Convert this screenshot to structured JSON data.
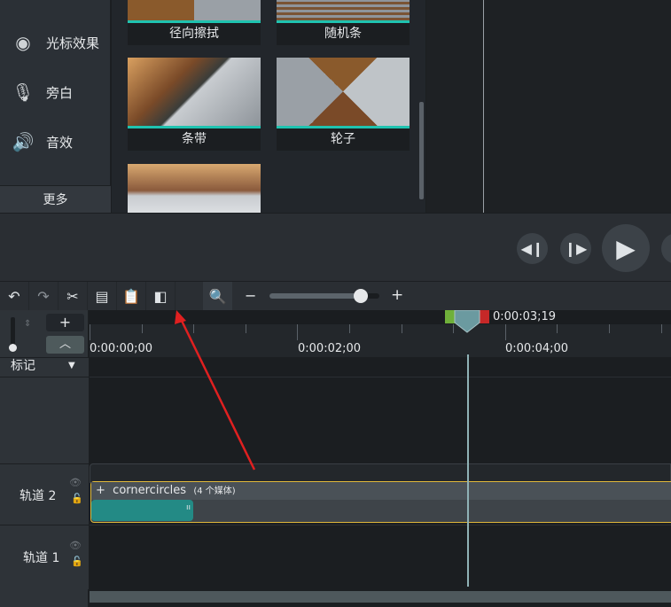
{
  "sidebar": {
    "items": [
      {
        "label": "光标效果",
        "icon": "cursor-effects-icon"
      },
      {
        "label": "旁白",
        "icon": "microphone-icon"
      },
      {
        "label": "音效",
        "icon": "speaker-icon"
      }
    ],
    "more": "更多"
  },
  "library": {
    "thumbnails": [
      {
        "label": "径向擦拭"
      },
      {
        "label": "随机条"
      },
      {
        "label": "条带"
      },
      {
        "label": "轮子"
      },
      {
        "label": ""
      }
    ]
  },
  "player": {
    "buttons": [
      "step-back",
      "step-forward",
      "play"
    ]
  },
  "toolbar": {
    "tools": [
      "undo",
      "redo",
      "cut",
      "copy",
      "paste",
      "split",
      "zoom",
      "zoom-out",
      "zoom-in"
    ],
    "zoom_level": 0.83
  },
  "timeline": {
    "playhead_time": "0:00:03;19",
    "ruler_labels": [
      "0:00:00;00",
      "0:00:02;00",
      "0:00:04;00"
    ],
    "marker_label": "标记",
    "tracks": [
      {
        "name": "轨道 2",
        "group": "cornercircles",
        "group_info": "(4 个媒体)"
      },
      {
        "name": "轨道 1"
      }
    ]
  },
  "colors": {
    "accent": "#1fc3b0",
    "clip": "#238a85",
    "selection": "#e0b83a",
    "arrow": "#e02020"
  }
}
